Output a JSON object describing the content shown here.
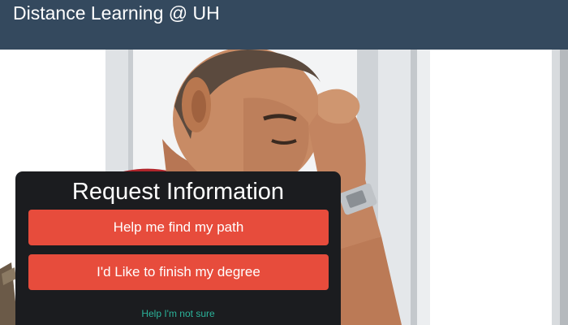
{
  "header": {
    "title": "Distance Learning @ UH",
    "background": "#34495e"
  },
  "hero": {
    "image": "photo of a student resting his head on his hand near a bright window"
  },
  "request_panel": {
    "title": "Request Information",
    "buttons": [
      {
        "label": "Help me find my path"
      },
      {
        "label": "I'd Like to finish my degree"
      }
    ],
    "help_link": "Help I'm not sure",
    "colors": {
      "panel": "#1b1c1f",
      "button": "#e74c3c",
      "link": "#2bb39a"
    }
  }
}
